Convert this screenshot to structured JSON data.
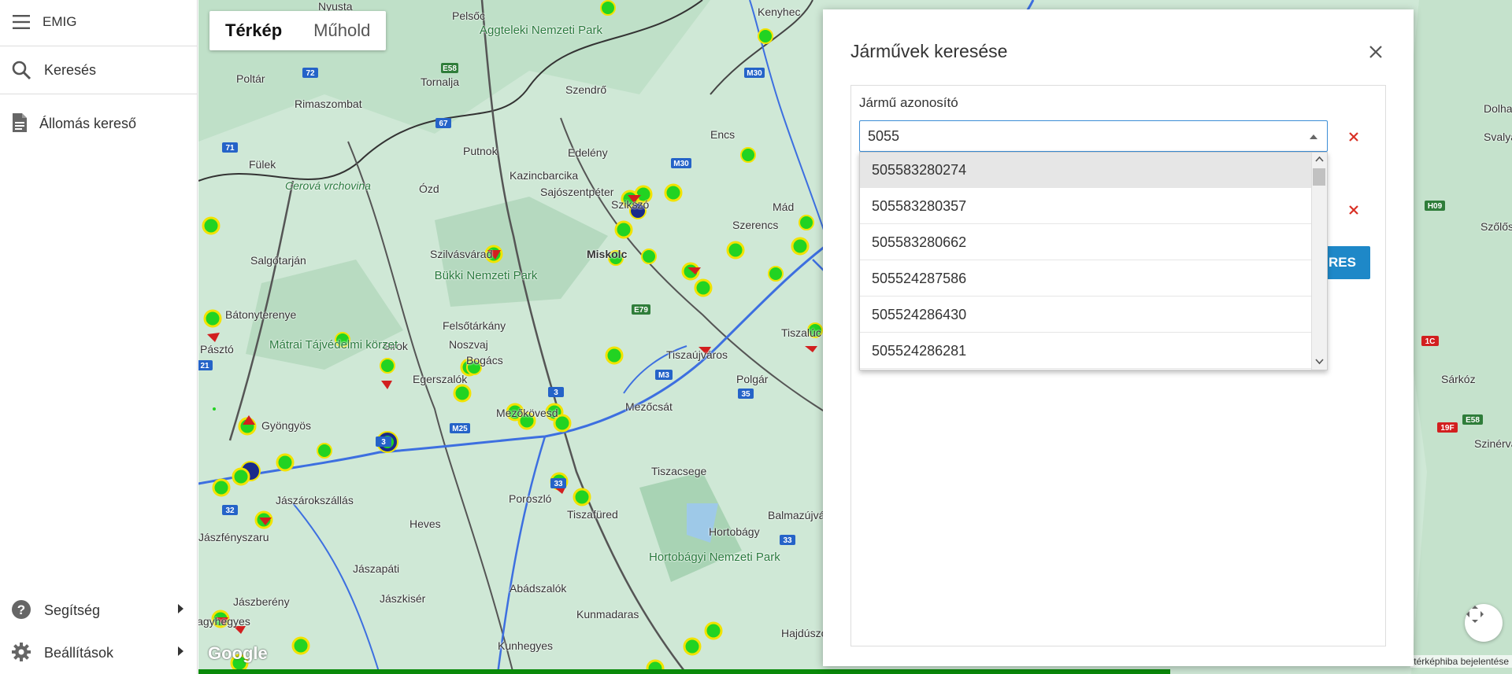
{
  "sidebar": {
    "app_name": "EMIG",
    "search_label": "Keresés",
    "station_search_label": "Állomás kereső",
    "help_label": "Segítség",
    "settings_label": "Beállítások"
  },
  "map": {
    "type_tabs": [
      "Térkép",
      "Műhold"
    ],
    "active_tab": "Térkép",
    "google_logo": "Google",
    "attribution": "térképhiba bejelentése",
    "progress_percent": 74,
    "places": [
      "Nyusta",
      "Pelsőc",
      "Aggteleki Nemzeti Park",
      "Kenyhec",
      "Poltár",
      "Tornalja",
      "Rimaszombat",
      "Szendrő",
      "Putnok",
      "Edelény",
      "Encs",
      "Fülek",
      "Cerová vrchovina",
      "Ózd",
      "Kazincbarcika",
      "Sajószentpéter",
      "Szikszó",
      "Mád",
      "Salgótarján",
      "Szilvásvárad",
      "Bükki Nemzeti Park",
      "Miskolc",
      "Szerencs",
      "Bátonyterenye",
      "Pásztó",
      "Felsőtárkány",
      "Noszvaj",
      "Sirok",
      "Mátrai Tájvédelmi körzet",
      "Bogács",
      "Tiszaújváros",
      "Tiszalúc",
      "Egerszalók",
      "Polgár",
      "Mezőkövesd",
      "Gyöngyös",
      "Mezőcsát",
      "Jászárokszállás",
      "Poroszló",
      "Tiszacsege",
      "Heves",
      "Tiszafüred",
      "Hortobágy",
      "Balmazújváros",
      "Jászfényszaru",
      "Jászberény",
      "Jászapáti",
      "Hortobágyi Nemzeti Park",
      "Abádszalók",
      "Jászkisér",
      "Kunmadaras",
      "Nagyhegyes",
      "Kunhegyes",
      "Hajdúszoboszló",
      "Sárkóz",
      "Szinérváralja",
      "Dolha",
      "Svalyava",
      "Szőlős"
    ]
  },
  "dialog": {
    "title": "Járművek keresése",
    "field_label": "Jármű azonosító",
    "input_value": "5055",
    "search_button_label": "RES",
    "options": [
      "505583280274",
      "505583280357",
      "505583280662",
      "505524287586",
      "505524286430",
      "505524286281"
    ],
    "highlighted_index": 0
  },
  "colors": {
    "accent": "#1e88c8",
    "remove": "#d93025",
    "station_green": "#22d322",
    "station_ring": "#f2e300"
  }
}
